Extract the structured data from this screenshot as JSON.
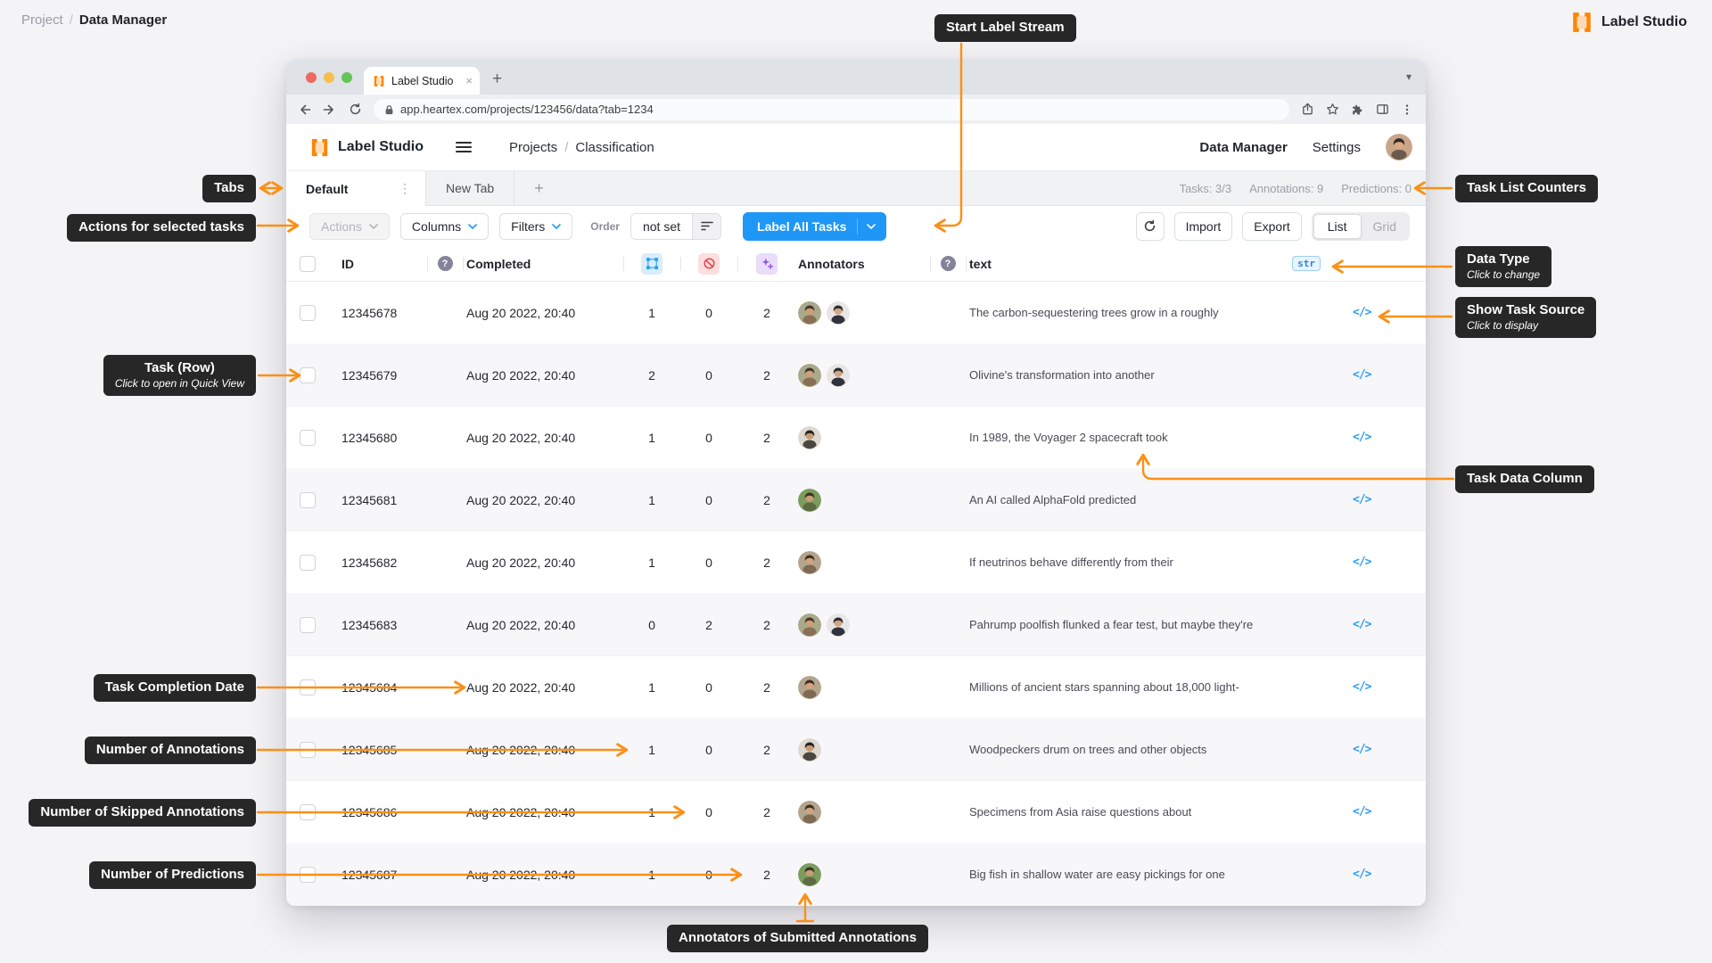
{
  "page": {
    "breadcrumb": {
      "root": "Project",
      "sep": "/",
      "current": "Data Manager"
    },
    "brand": "Label Studio"
  },
  "browser": {
    "tab_title": "Label Studio",
    "close_tab": "×",
    "url": "app.heartex.com/projects/123456/data?tab=1234"
  },
  "app_header": {
    "brand": "Label Studio",
    "nav_root": "Projects",
    "nav_sep": "/",
    "nav_current": "Classification",
    "link_data_manager": "Data Manager",
    "link_settings": "Settings"
  },
  "view_tabs": {
    "tabs": [
      {
        "label": "Default"
      },
      {
        "label": "New Tab"
      }
    ],
    "kebab": "⋮",
    "add": "+",
    "counters": [
      "Tasks: 3/3",
      "Annotations: 9",
      "Predictions: 0"
    ]
  },
  "toolbar": {
    "actions": "Actions",
    "columns": "Columns",
    "filters": "Filters",
    "order_label": "Order",
    "order_value": "not set",
    "label_all": "Label All Tasks",
    "import": "Import",
    "export": "Export",
    "list": "List",
    "grid": "Grid"
  },
  "table": {
    "headers": {
      "id": "ID",
      "completed": "Completed",
      "annotators": "Annotators",
      "text": "text",
      "data_type_badge": "str",
      "help": "?"
    },
    "source_icon": "</>",
    "rows": [
      {
        "id": "12345678",
        "completed": "Aug 20 2022, 20:40",
        "annotations": "1",
        "skipped": "0",
        "predictions": "2",
        "avatars": [
          "A",
          "B"
        ],
        "text": "The carbon-sequestering trees grow in a roughly"
      },
      {
        "id": "12345679",
        "completed": "Aug 20 2022, 20:40",
        "annotations": "2",
        "skipped": "0",
        "predictions": "2",
        "avatars": [
          "A",
          "B"
        ],
        "text": "Olivine's transformation into another"
      },
      {
        "id": "12345680",
        "completed": "Aug 20 2022, 20:40",
        "annotations": "1",
        "skipped": "0",
        "predictions": "2",
        "avatars": [
          "C"
        ],
        "text": "In 1989, the Voyager 2 spacecraft took"
      },
      {
        "id": "12345681",
        "completed": "Aug 20 2022, 20:40",
        "annotations": "1",
        "skipped": "0",
        "predictions": "2",
        "avatars": [
          "D"
        ],
        "text": "An AI called AlphaFold predicted"
      },
      {
        "id": "12345682",
        "completed": "Aug 20 2022, 20:40",
        "annotations": "1",
        "skipped": "0",
        "predictions": "2",
        "avatars": [
          "E"
        ],
        "text": "If neutrinos behave differently from their"
      },
      {
        "id": "12345683",
        "completed": "Aug 20 2022, 20:40",
        "annotations": "0",
        "skipped": "2",
        "predictions": "2",
        "avatars": [
          "A",
          "B"
        ],
        "text": "Pahrump poolfish flunked a fear test, but maybe they're"
      },
      {
        "id": "12345684",
        "completed": "Aug 20 2022, 20:40",
        "annotations": "1",
        "skipped": "0",
        "predictions": "2",
        "avatars": [
          "E"
        ],
        "text": "Millions of ancient stars spanning about 18,000 light-"
      },
      {
        "id": "12345685",
        "completed": "Aug 20 2022, 20:40",
        "annotations": "1",
        "skipped": "0",
        "predictions": "2",
        "avatars": [
          "C"
        ],
        "text": "Woodpeckers drum on trees and other objects"
      },
      {
        "id": "12345686",
        "completed": "Aug 20 2022, 20:40",
        "annotations": "1",
        "skipped": "0",
        "predictions": "2",
        "avatars": [
          "E"
        ],
        "text": "Specimens from Asia raise questions about"
      },
      {
        "id": "12345687",
        "completed": "Aug 20 2022, 20:40",
        "annotations": "1",
        "skipped": "0",
        "predictions": "2",
        "avatars": [
          "D"
        ],
        "text": "Big fish in shallow water are easy pickings for one"
      }
    ]
  },
  "avatar_palette": {
    "A": {
      "bg": "#a9a98b",
      "skin": "#cf9f78",
      "hair": "#43382e",
      "shirt": "#8a6f55"
    },
    "B": {
      "bg": "#e7e6e4",
      "skin": "#d3a582",
      "hair": "#2b2b33",
      "shirt": "#30333e"
    },
    "C": {
      "bg": "#ddd8d0",
      "skin": "#c89a72",
      "hair": "#26221f",
      "shirt": "#4a4640"
    },
    "D": {
      "bg": "#7c9c5e",
      "skin": "#cb9d76",
      "hair": "#3c3227",
      "shirt": "#5d6b43"
    },
    "E": {
      "bg": "#b3a58d",
      "skin": "#d2a47d",
      "hair": "#3f3026",
      "shirt": "#7d6a52"
    },
    "H": {
      "bg": "#c9a58a",
      "skin": "#d8ab83",
      "hair": "#332c26",
      "shirt": "#6b5a49"
    }
  },
  "callouts": {
    "start_label_stream": "Start Label Stream",
    "tabs": "Tabs",
    "actions": "Actions for selected tasks",
    "task_row": {
      "label": "Task (Row)",
      "sub": "Click to open in Quick View"
    },
    "task_list_counters": "Task List Counters",
    "data_type": {
      "label": "Data Type",
      "sub": "Click to change"
    },
    "show_task_source": {
      "label": "Show Task Source",
      "sub": "Click to display"
    },
    "task_data_column": "Task Data Column",
    "task_completion_date": "Task Completion Date",
    "number_of_annotations": "Number of Annotations",
    "number_of_skipped": "Number of Skipped Annotations",
    "number_of_predictions": "Number of Predictions",
    "annotators_submitted": "Annotators of Submitted Annotations"
  },
  "colors": {
    "callout_arrow_orange": "#FA9016",
    "primary_blue": "#1f97f7",
    "badge_blue": "#2f80ed",
    "logo_orange": "#ff8400"
  }
}
